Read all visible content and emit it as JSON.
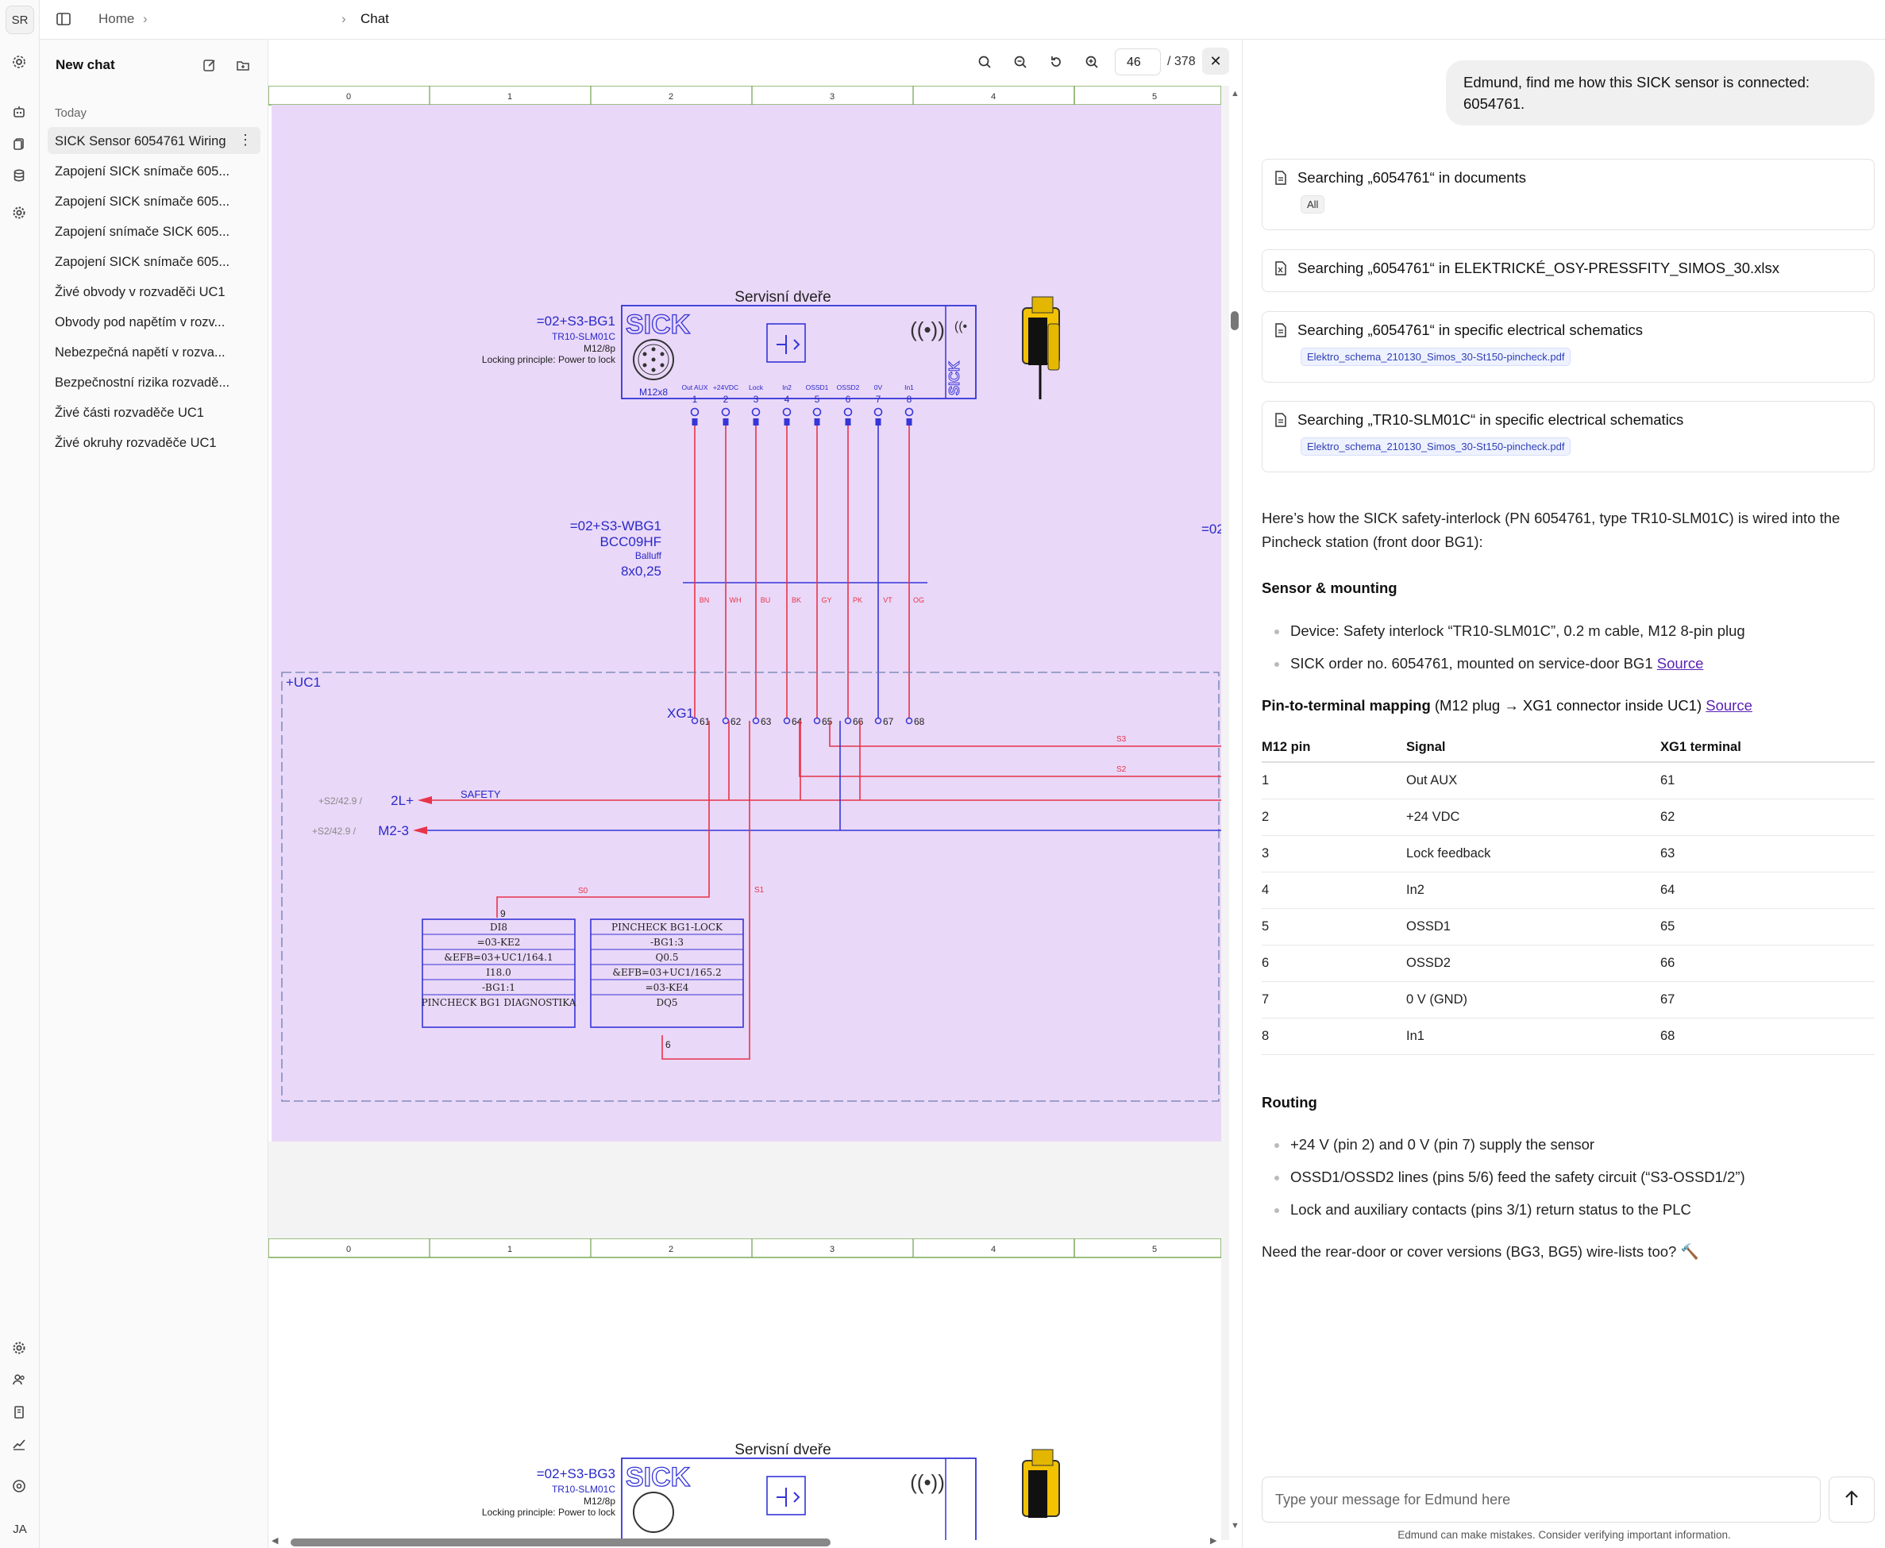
{
  "rail": {
    "top_avatar": "SR",
    "bottom_avatar": "JA"
  },
  "breadcrumb": {
    "home": "Home",
    "current": "Chat"
  },
  "sidebar": {
    "new_chat": "New chat",
    "section": "Today",
    "items": [
      "SICK Sensor 6054761 Wiring",
      "Zapojení SICK snímače 605...",
      "Zapojení SICK snímače 605...",
      "Zapojení snímače SICK 605...",
      "Zapojení SICK snímače 605...",
      "Živé obvody v rozvaděči UC1",
      "Obvody pod napětím v rozv...",
      "Nebezpečná napětí v rozva...",
      "Bezpečnostní rizika rozvadě...",
      "Živé části rozvaděče UC1",
      "Živé okruhy rozvaděče UC1"
    ]
  },
  "viewer": {
    "page": "46",
    "total": "/ 378",
    "columns": [
      "0",
      "1",
      "2",
      "3",
      "4",
      "5"
    ],
    "schematic": {
      "title": "Servisní dveře",
      "device_tag": "=02+S3-BG1",
      "device_tag2": "=02+S3-BG3",
      "brand": "SICK",
      "model": "TR10-SLM01C",
      "connector": "M12/8p",
      "locking": "Locking principle:  Power to lock",
      "plug": "M12x8",
      "pin_labels": [
        "Out AUX",
        "+24VDC",
        "Lock",
        "In2",
        "OSSD1",
        "OSSD2",
        "0V",
        "In1"
      ],
      "pins": [
        "1",
        "2",
        "3",
        "4",
        "5",
        "6",
        "7",
        "8"
      ],
      "cable_tag": "=02+S3-WBG1",
      "cable_type": "BCC09HF",
      "cable_brand": "Balluff",
      "cable_size": "8x0,25",
      "wire_colors": [
        "BN",
        "WH",
        "BU",
        "BK",
        "GY",
        "PK",
        "VT",
        "OG"
      ],
      "cabinet": "+UC1",
      "terminal": "XG1",
      "terminals": [
        "61",
        "62",
        "63",
        "64",
        "65",
        "66",
        "67",
        "68"
      ],
      "ref1": "+S2/42.9 /",
      "net1": "2L+",
      "safety": "SAFETY",
      "ref2": "+S2/42.9 /",
      "net2": "M2-3",
      "tag_s3": "S3",
      "tag_s2": "S2",
      "tag_s0": "S0",
      "tag_s1": "S1",
      "box1": [
        "DI8",
        "=03-KE2",
        "&EFB=03+UC1/164.1",
        "I18.0",
        "-BG1:1",
        "PINCHECK BG1 DIAGNOSTIKA"
      ],
      "box1_pin": "9",
      "box2": [
        "PINCHECK BG1-LOCK",
        "-BG1:3",
        "Q0.5",
        "&EFB=03+UC1/165.2",
        "=03-KE4",
        "DQ5"
      ],
      "box2_pin": "6",
      "edge_tag": "=02"
    }
  },
  "chat": {
    "user_message": "Edmund, find me how this SICK sensor is connected: 6054761.",
    "tools": [
      {
        "text": "Searching „6054761“ in documents",
        "chip": "All",
        "icon": "document-icon"
      },
      {
        "text": "Searching „6054761“ in ELEKTRICKÉ_OSY-PRESSFITY_SIMOS_30.xlsx",
        "chip": "",
        "icon": "spreadsheet-icon"
      },
      {
        "text": "Searching „6054761“ in specific electrical schematics",
        "chip": "Elektro_schema_210130_Simos_30-St150-pincheck.pdf",
        "icon": "document-icon"
      },
      {
        "text": "Searching „TR10-SLM01C“ in specific electrical schematics",
        "chip": "Elektro_schema_210130_Simos_30-St150-pincheck.pdf",
        "icon": "document-icon"
      }
    ],
    "intro": "Here’s how the SICK safety-interlock (PN 6054761, type TR10-SLM01C) is wired into the Pincheck station (front door BG1):",
    "h_sensor": "Sensor & mounting",
    "sensor_b1": "Device: Safety interlock “TR10-SLM01C”, 0.2 m cable, M12 8-pin plug",
    "sensor_b2": "SICK order no. 6054761, mounted on service-door BG1",
    "source": "Source",
    "h_pin": "Pin-to-terminal mapping",
    "h_pin_note": "(M12 plug → XG1 connector inside UC1)",
    "table_headers": [
      "M12 pin",
      "Signal",
      "XG1 terminal"
    ],
    "table_rows": [
      [
        "1",
        "Out AUX",
        "61"
      ],
      [
        "2",
        "+24 VDC",
        "62"
      ],
      [
        "3",
        "Lock feedback",
        "63"
      ],
      [
        "4",
        "In2",
        "64"
      ],
      [
        "5",
        "OSSD1",
        "65"
      ],
      [
        "6",
        "OSSD2",
        "66"
      ],
      [
        "7",
        "0 V (GND)",
        "67"
      ],
      [
        "8",
        "In1",
        "68"
      ]
    ],
    "h_routing": "Routing",
    "routing": [
      "+24 V (pin 2) and 0 V (pin 7) supply the sensor",
      "OSSD1/OSSD2 lines (pins 5/6) feed the safety circuit (“S3-OSSD1/2”)",
      "Lock and auxiliary contacts (pins 3/1) return status to the PLC"
    ],
    "closing": "Need the rear-door or cover versions (BG3, BG5) wire-lists too? 🔨",
    "input_placeholder": "Type your message for Edmund here",
    "disclaimer": "Edmund can make mistakes. Consider verifying important information."
  },
  "colors": {
    "schematic_bg": "#ead8f8",
    "wire_red": "#e8334a",
    "wire_blue": "#3535d8",
    "accent_link": "#5b21b6"
  }
}
